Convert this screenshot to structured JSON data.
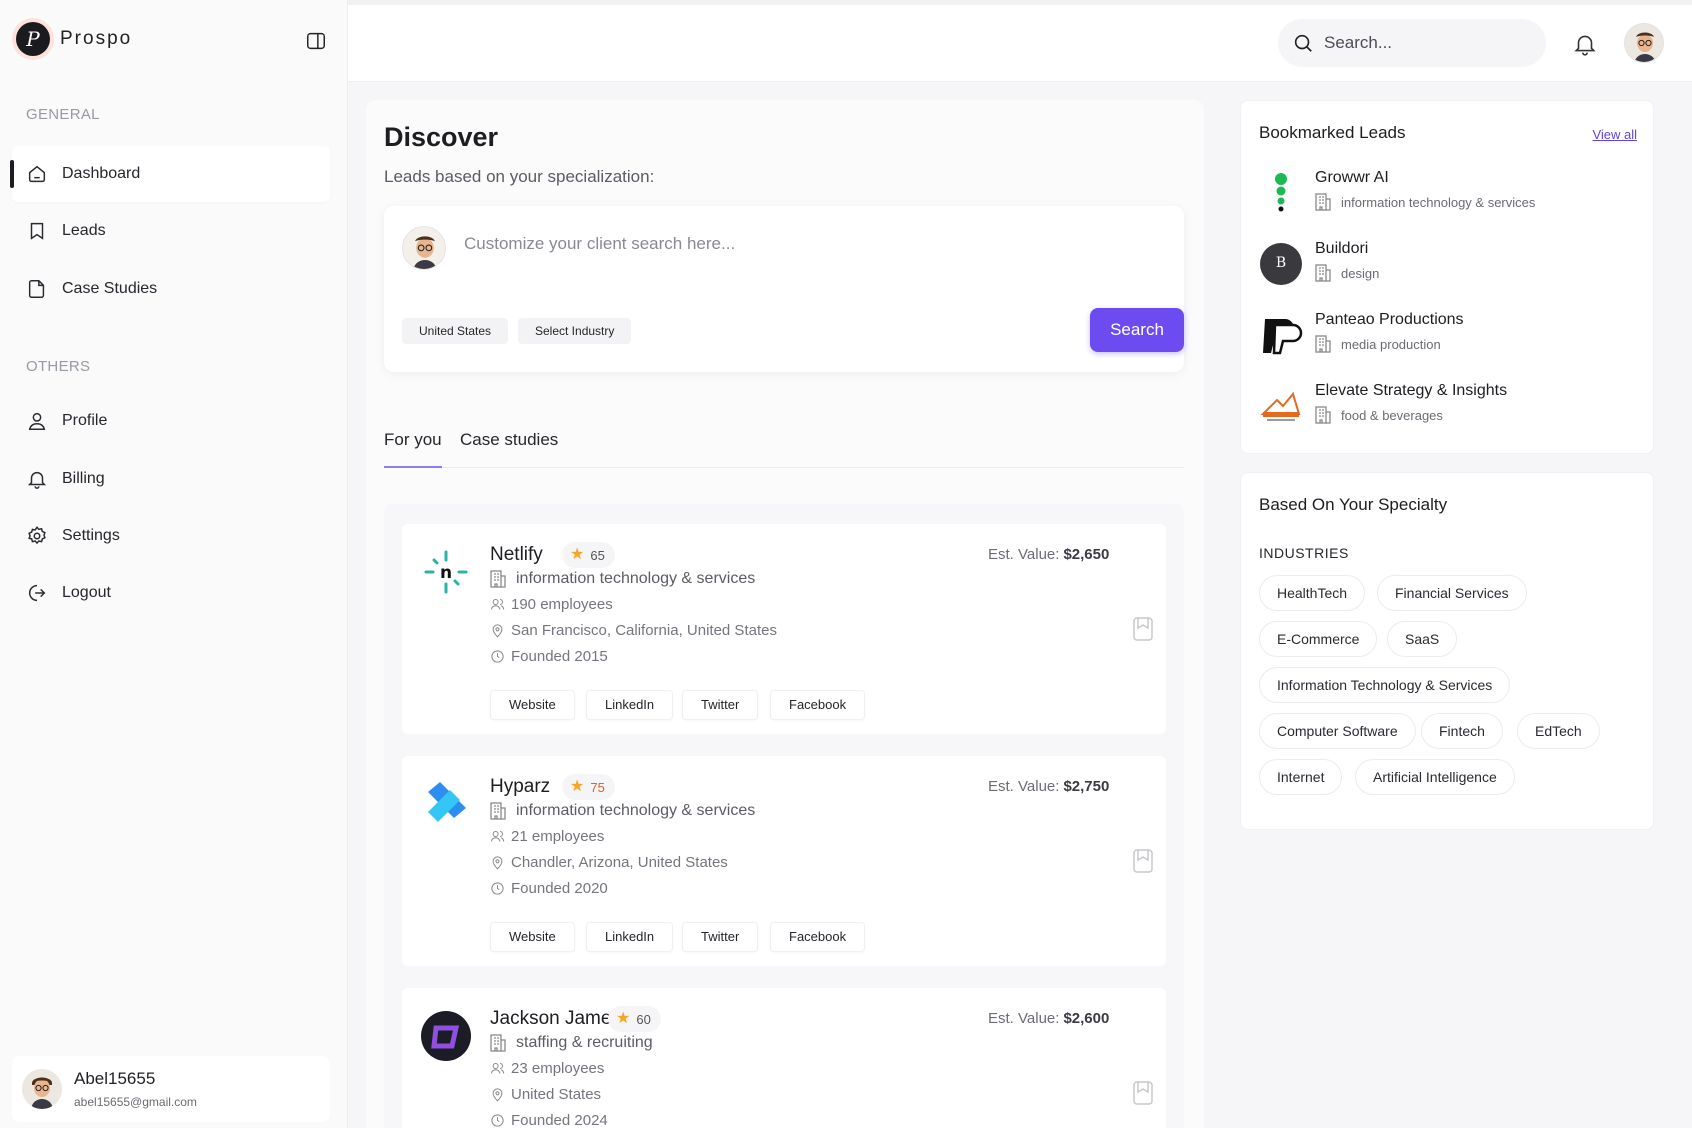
{
  "app": {
    "name": "Prospo"
  },
  "sidebar": {
    "general_label": "GENERAL",
    "others_label": "OTHERS",
    "general_items": [
      {
        "label": "Dashboard",
        "icon": "home-icon",
        "active": true
      },
      {
        "label": "Leads",
        "icon": "bookmark-icon"
      },
      {
        "label": "Case Studies",
        "icon": "document-icon"
      }
    ],
    "other_items": [
      {
        "label": "Profile",
        "icon": "user-icon"
      },
      {
        "label": "Billing",
        "icon": "bell-icon"
      },
      {
        "label": "Settings",
        "icon": "gear-icon"
      },
      {
        "label": "Logout",
        "icon": "logout-icon"
      }
    ],
    "user": {
      "name": "Abel15655",
      "email": "abel15655@gmail.com"
    }
  },
  "header": {
    "search_placeholder": "Search..."
  },
  "main": {
    "title": "Discover",
    "subtitle": "Leads based on your specialization:",
    "prompt_placeholder": "Customize your client search here...",
    "filters": [
      "United States",
      "Select Industry"
    ],
    "search_button": "Search",
    "tabs": [
      {
        "label": "For you",
        "active": true
      },
      {
        "label": "Case studies"
      }
    ],
    "est_value_label": "Est. Value:",
    "leads": [
      {
        "name": "Netlify",
        "score": "65",
        "est_value": "$2,650",
        "industry": "information technology & services",
        "employees": "190 employees",
        "location": "San Francisco, California, United States",
        "founded": "Founded 2015",
        "links": [
          "Website",
          "LinkedIn",
          "Twitter",
          "Facebook"
        ],
        "score_color": "#555555"
      },
      {
        "name": "Hyparz",
        "score": "75",
        "est_value": "$2,750",
        "industry": "information technology & services",
        "employees": "21 employees",
        "location": "Chandler, Arizona, United States",
        "founded": "Founded 2020",
        "links": [
          "Website",
          "LinkedIn",
          "Twitter",
          "Facebook"
        ],
        "score_color": "#e0621d"
      },
      {
        "name": "Jackson James",
        "score": "60",
        "est_value": "$2,600",
        "industry": "staffing & recruiting",
        "employees": "23 employees",
        "location": "United States",
        "founded": "Founded 2024",
        "links": [],
        "score_color": "#555555"
      }
    ]
  },
  "bookmarked": {
    "title": "Bookmarked Leads",
    "view_all": "View all",
    "items": [
      {
        "name": "Growwr AI",
        "industry": "information technology & services"
      },
      {
        "name": "Buildori",
        "industry": "design"
      },
      {
        "name": "Panteao Productions",
        "industry": "media production"
      },
      {
        "name": "Elevate Strategy & Insights",
        "industry": "food & beverages"
      }
    ]
  },
  "specialty": {
    "title": "Based On Your Specialty",
    "industries_label": "INDUSTRIES",
    "industries": [
      "HealthTech",
      "Financial Services",
      "E-Commerce",
      "SaaS",
      "Information Technology & Services",
      "Computer Software",
      "Fintech",
      "EdTech",
      "Internet",
      "Artificial Intelligence"
    ]
  },
  "colors": {
    "accent": "#6c4cf0",
    "star": "#f5a623"
  }
}
